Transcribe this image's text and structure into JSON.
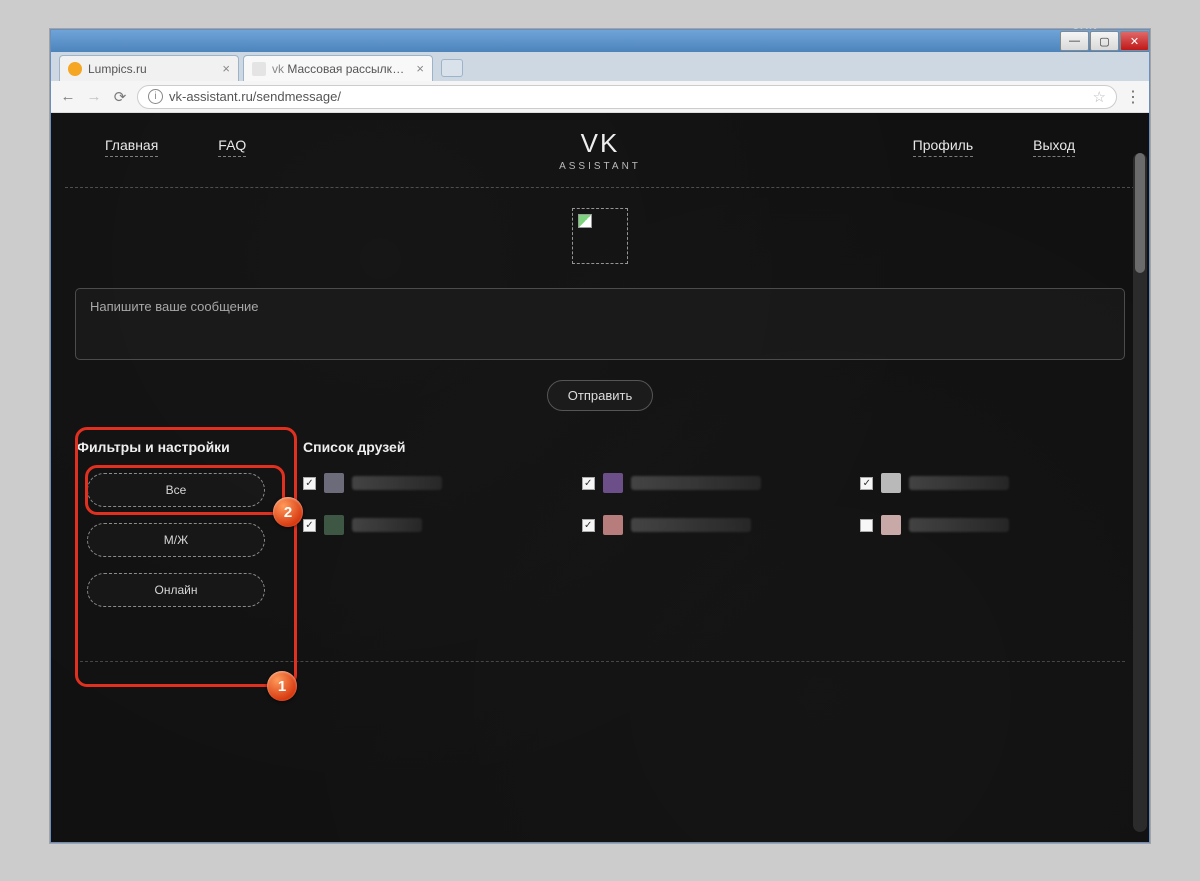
{
  "lang_indicator": "JAN",
  "tabs": [
    {
      "title": "Lumpics.ru",
      "favicon": "orange"
    },
    {
      "title": "Массовая рассылка соо…",
      "favicon": "vk",
      "prefix": "vk"
    }
  ],
  "url": "vk-assistant.ru/sendmessage/",
  "brand": {
    "title": "VK",
    "subtitle": "ASSISTANT"
  },
  "nav": {
    "home": "Главная",
    "faq": "FAQ",
    "profile": "Профиль",
    "logout": "Выход"
  },
  "message": {
    "placeholder": "Напишите ваше сообщение",
    "send": "Отправить"
  },
  "filters": {
    "title": "Фильтры и настройки",
    "all": "Все",
    "gender": "М/Ж",
    "online": "Онлайн"
  },
  "friends": {
    "title": "Список друзей",
    "items": [
      {
        "checked": true,
        "avatar": "#6b6b7a",
        "name_w": 90
      },
      {
        "checked": true,
        "avatar": "#6c4f88",
        "name_w": 130
      },
      {
        "checked": true,
        "avatar": "#b9b9b9",
        "name_w": 100
      },
      {
        "checked": true,
        "avatar": "#3e5745",
        "name_w": 70
      },
      {
        "checked": true,
        "avatar": "#b77c7c",
        "name_w": 120
      },
      {
        "checked": false,
        "avatar": "#c9a8a8",
        "name_w": 100
      }
    ]
  },
  "annotations": {
    "b1": "1",
    "b2": "2"
  }
}
